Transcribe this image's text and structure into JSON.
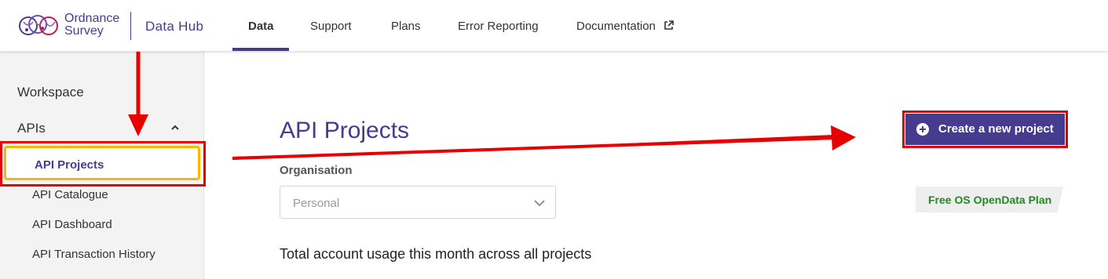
{
  "header": {
    "logo_line1": "Ordnance",
    "logo_line2": "Survey",
    "product": "Data Hub",
    "nav": [
      {
        "label": "Data"
      },
      {
        "label": "Support"
      },
      {
        "label": "Plans"
      },
      {
        "label": "Error Reporting"
      },
      {
        "label": "Documentation"
      }
    ]
  },
  "sidebar": {
    "workspace": "Workspace",
    "apis": "APIs",
    "items": [
      {
        "label": "API Projects"
      },
      {
        "label": "API Catalogue"
      },
      {
        "label": "API Dashboard"
      },
      {
        "label": "API Transaction History"
      }
    ]
  },
  "main": {
    "title": "API Projects",
    "organisation_label": "Organisation",
    "organisation_value": "Personal",
    "create_button": "Create a new project",
    "plan_badge": "Free OS OpenData Plan",
    "usage_text": "Total account usage this month across all projects"
  },
  "colors": {
    "brand": "#453c90",
    "annotation": "#e80000",
    "highlight": "#f5b800",
    "plan": "#1f8a1f"
  },
  "icons": [
    "os-logo-icon",
    "external-link-icon",
    "chevron-up-icon",
    "chevron-down-icon",
    "plus-circle-icon"
  ]
}
